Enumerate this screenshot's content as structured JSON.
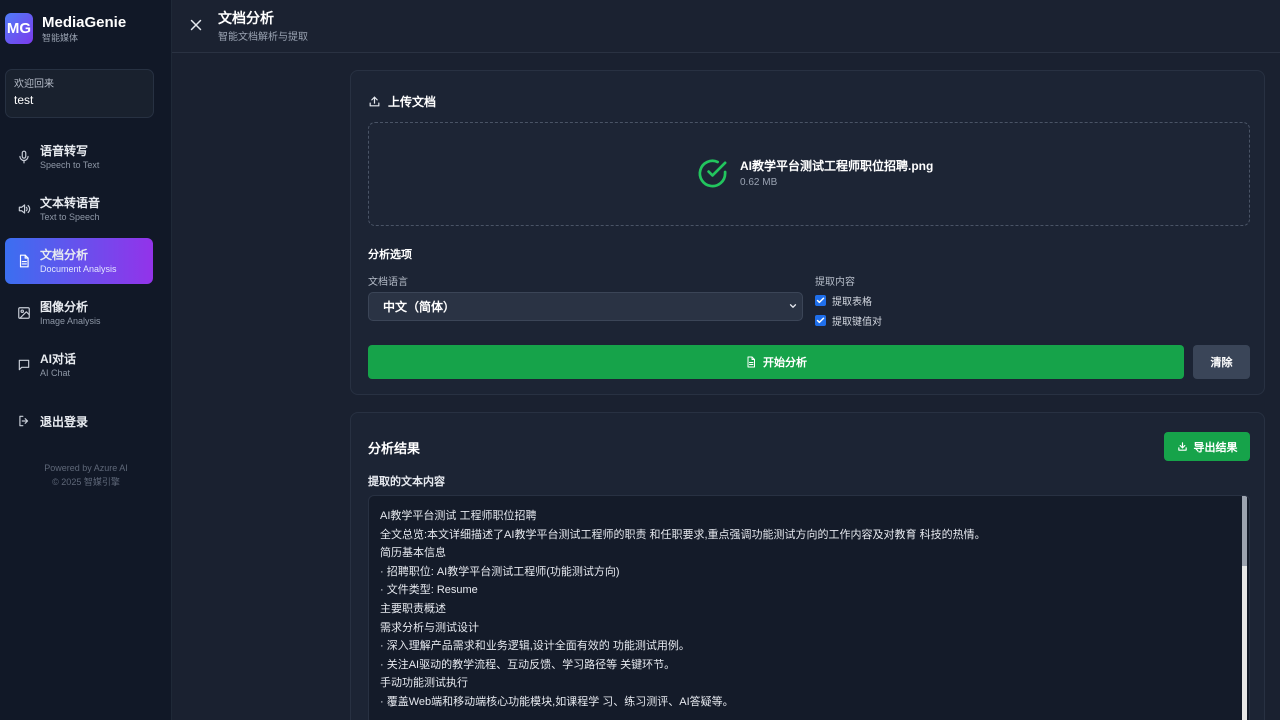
{
  "app": {
    "logo": "MG",
    "name": "MediaGenie",
    "tagline": "智能媒体"
  },
  "welcome": {
    "greeting": "欢迎回来",
    "user": "test"
  },
  "nav": {
    "items": [
      {
        "label": "语音转写",
        "sub": "Speech to Text",
        "icon": "microphone-icon"
      },
      {
        "label": "文本转语音",
        "sub": "Text to Speech",
        "icon": "speaker-icon"
      },
      {
        "label": "文档分析",
        "sub": "Document Analysis",
        "icon": "document-icon",
        "active": true
      },
      {
        "label": "图像分析",
        "sub": "Image Analysis",
        "icon": "image-icon"
      },
      {
        "label": "AI对话",
        "sub": "AI Chat",
        "icon": "chat-icon"
      }
    ],
    "logout": "退出登录"
  },
  "footer": {
    "line1": "Powered by Azure AI",
    "line2": "© 2025 智媒引擎"
  },
  "header": {
    "title": "文档分析",
    "subtitle": "智能文档解析与提取"
  },
  "upload": {
    "title": "上传文档",
    "file_name": "AI教学平台测试工程师职位招聘.png",
    "file_size": "0.62 MB"
  },
  "options": {
    "title": "分析选项",
    "language_label": "文档语言",
    "language_value": "中文（简体）",
    "extract_label": "提取内容",
    "extract_tables": "提取表格",
    "extract_kv": "提取键值对",
    "tables_checked": true,
    "kv_checked": true
  },
  "actions": {
    "analyze": "开始分析",
    "clear": "清除"
  },
  "results": {
    "title": "分析结果",
    "export": "导出结果",
    "text_label": "提取的文本内容",
    "lines": [
      "AI教学平台测试 工程师职位招聘",
      "全文总览:本文详细描述了AI教学平台测试工程师的职责 和任职要求,重点强调功能测试方向的工作内容及对教育 科技的热情。",
      "简历基本信息",
      "· 招聘职位: AI教学平台测试工程师(功能测试方向)",
      "· 文件类型: Resume",
      "主要职责概述",
      "需求分析与测试设计",
      "· 深入理解产品需求和业务逻辑,设计全面有效的 功能测试用例。",
      "· 关注AI驱动的教学流程、互动反馈、学习路径等 关键环节。",
      "手动功能测试执行",
      "· 覆盖Web端和移动端核心功能模块,如课程学 习、练习测评、AI答疑等。"
    ]
  },
  "colors": {
    "accent_green": "#16a34a",
    "active_gradient_start": "#3b6ff0",
    "active_gradient_end": "#9333ea",
    "checkbox_blue": "#1f6feb"
  }
}
